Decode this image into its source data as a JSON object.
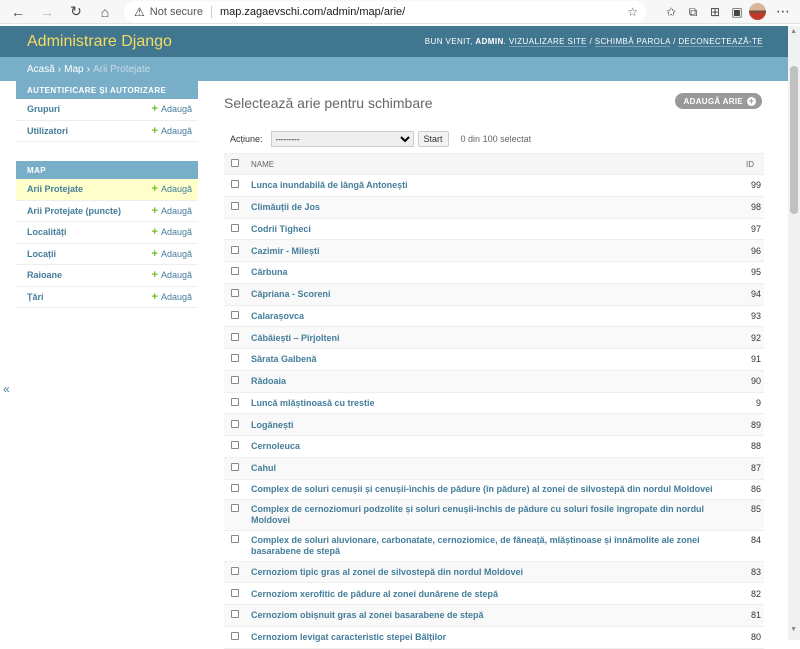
{
  "browser": {
    "security_label": "Not secure",
    "url": "map.zagaevschi.com/admin/map/arie/"
  },
  "header": {
    "branding": "Administrare Django",
    "welcome": "BUN VENIT,",
    "username": "ADMIN",
    "view_site": "VIZUALIZARE SITE",
    "change_password": "SCHIMBĂ PAROLA",
    "logout": "DECONECTEAZĂ-TE",
    "separator": "/"
  },
  "breadcrumbs": {
    "home": "Acasă",
    "app": "Map",
    "current": "Arii Protejate",
    "sep": "›"
  },
  "sidebar": {
    "modules": [
      {
        "caption": "AUTENTIFICARE ȘI AUTORIZARE",
        "rows": [
          {
            "label": "Grupuri",
            "add": "Adaugă"
          },
          {
            "label": "Utilizatori",
            "add": "Adaugă"
          }
        ]
      },
      {
        "caption": "MAP",
        "rows": [
          {
            "label": "Arii Protejate",
            "add": "Adaugă"
          },
          {
            "label": "Arii Protejate (puncte)",
            "add": "Adaugă"
          },
          {
            "label": "Localități",
            "add": "Adaugă"
          },
          {
            "label": "Locații",
            "add": "Adaugă"
          },
          {
            "label": "Raioane",
            "add": "Adaugă"
          },
          {
            "label": "Țări",
            "add": "Adaugă"
          }
        ]
      }
    ],
    "collapse_glyph": "«"
  },
  "content": {
    "title": "Selectează arie pentru schimbare",
    "add_button": "ADAUGĂ ARIE",
    "actions_label": "Acțiune:",
    "actions_selected": "---------",
    "go_button": "Start",
    "counter": "0 din 100 selectat",
    "columns": {
      "name": "NAME",
      "id": "ID"
    },
    "rows": [
      {
        "name": "Lunca inundabilă de lângă Antonești",
        "id": "99"
      },
      {
        "name": "Climăuții de Jos",
        "id": "98"
      },
      {
        "name": "Codrii Tigheci",
        "id": "97"
      },
      {
        "name": "Cazimir - Milești",
        "id": "96"
      },
      {
        "name": "Cărbuna",
        "id": "95"
      },
      {
        "name": "Căpriana - Scoreni",
        "id": "94"
      },
      {
        "name": "Calarașovca",
        "id": "93"
      },
      {
        "name": "Căbăiești – Pîrjolteni",
        "id": "92"
      },
      {
        "name": "Sărata Galbenă",
        "id": "91"
      },
      {
        "name": "Rădoaia",
        "id": "90"
      },
      {
        "name": "Luncă mlăștinoasă cu trestie",
        "id": "9"
      },
      {
        "name": "Logănești",
        "id": "89"
      },
      {
        "name": "Cernoleuca",
        "id": "88"
      },
      {
        "name": "Cahul",
        "id": "87"
      },
      {
        "name": "Complex de soluri cenușii și cenușii-închis de pădure (în pădure) al zonei de silvostepă din nordul Moldovei",
        "id": "86"
      },
      {
        "name": "Complex de cernoziomuri podzolite și soluri cenușii-închis de pădure cu soluri fosile îngropate din nordul Moldovei",
        "id": "85"
      },
      {
        "name": "Complex de soluri aluvionare, carbonatate, cernoziomice, de fâneață, mlăștinoase și înnămolite ale zonei basarabene de stepă",
        "id": "84"
      },
      {
        "name": "Cernoziom tipic gras al zonei de silvostepă din nordul Moldovei",
        "id": "83"
      },
      {
        "name": "Cernoziom xerofitic de pădure al zonei dunărene de stepă",
        "id": "82"
      },
      {
        "name": "Cernoziom obișnuit gras al zonei basarabene de stepă",
        "id": "81"
      },
      {
        "name": "Cernoziom levigat caracteristic stepei Bălților",
        "id": "80"
      }
    ]
  },
  "colors": {
    "header_bg": "#417690",
    "branding": "#f5dd5d",
    "breadcrumb_bg": "#79aec8",
    "link": "#447e9b",
    "add_green": "#70bf2b",
    "current_row": "#ffffcc"
  }
}
